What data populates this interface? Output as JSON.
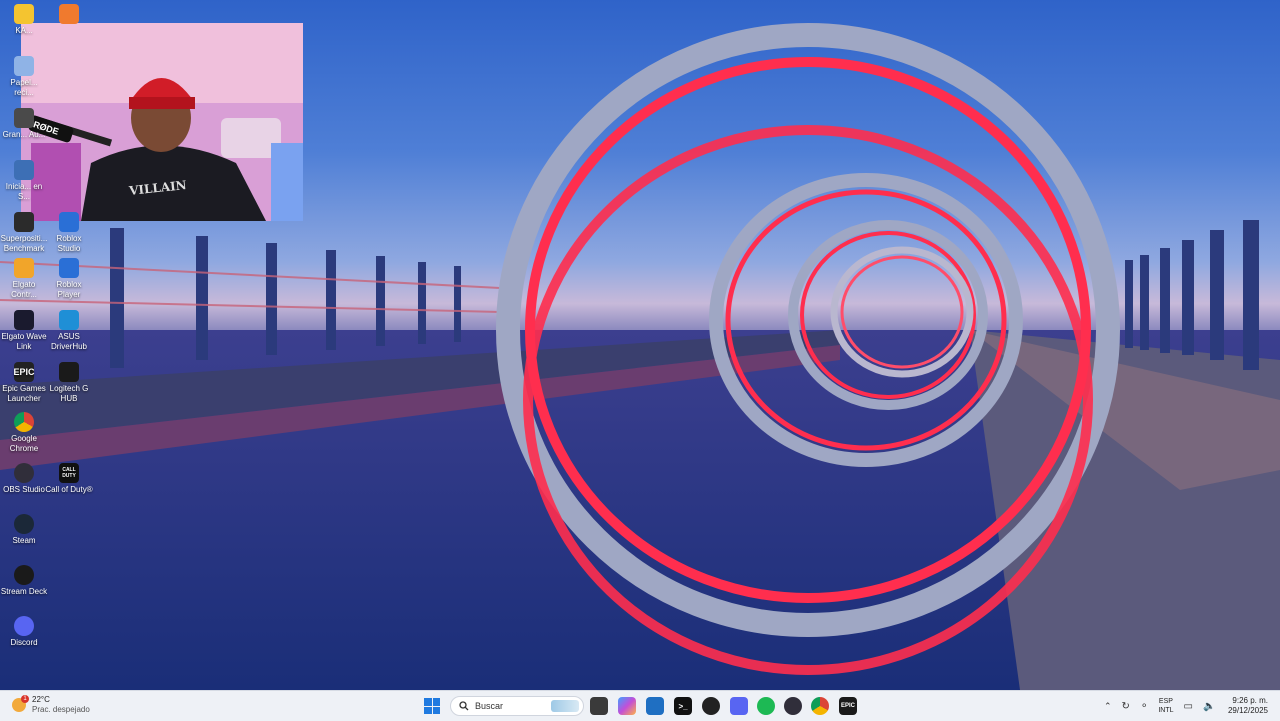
{
  "desktop": {
    "icons": [
      {
        "label": "KA...",
        "glyph": "",
        "color": "#f4c430"
      },
      {
        "label": "Papel... reci...",
        "glyph": "",
        "color": "#8fb3e6"
      },
      {
        "label": "Gran... Au...",
        "glyph": "",
        "color": "#4a4a4a"
      },
      {
        "label": "Inicia... en S...",
        "glyph": "",
        "color": "#3d6fb5"
      },
      {
        "label": "Superpositi... Benchmark",
        "glyph": "",
        "color": "#2b2b2b"
      },
      {
        "label": "Roblox Studio",
        "glyph": "",
        "color": "#2a6fd6"
      },
      {
        "label": "Elgato Contr...",
        "glyph": "",
        "color": "#f1a52a"
      },
      {
        "label": "Roblox Player",
        "glyph": "",
        "color": "#2a6fd6"
      },
      {
        "label": "Elgato Wave Link",
        "glyph": "",
        "color": "#1a1a2e"
      },
      {
        "label": "ASUS DriverHub",
        "glyph": "",
        "color": "#1f8fd6"
      },
      {
        "label": "Epic Games Launcher",
        "glyph": "EPIC",
        "color": "#222222"
      },
      {
        "label": "Logitech G HUB",
        "glyph": "",
        "color": "#1a1a1a"
      },
      {
        "label": "Google Chrome",
        "glyph": "",
        "color": "#db4437"
      },
      {
        "label": "OBS Studio",
        "glyph": "",
        "color": "#302e3a"
      },
      {
        "label": "Call of Duty®",
        "glyph": "CALL DUTY",
        "color": "#111111"
      },
      {
        "label": "Steam",
        "glyph": "",
        "color": "#1b2838"
      },
      {
        "label": "Stream Deck",
        "glyph": "",
        "color": "#1a1a1a"
      },
      {
        "label": "Discord",
        "glyph": "",
        "color": "#5865f2"
      }
    ]
  },
  "webcam": {
    "mic_brand": "RØDE",
    "hoodie_text": "VILLAIN"
  },
  "taskbar": {
    "weather": {
      "badge": "1",
      "temp": "22°C",
      "condition": "Prac. despejado"
    },
    "search_placeholder": "Buscar",
    "apps": [
      {
        "name": "file-explorer",
        "color": "#3a3a3a",
        "glyph": ""
      },
      {
        "name": "copilot",
        "color": "#c24fd8",
        "glyph": ""
      },
      {
        "name": "microsoft-store",
        "color": "#1f6fc2",
        "glyph": ""
      },
      {
        "name": "terminal",
        "color": "#111111",
        "glyph": ">_"
      },
      {
        "name": "app-6",
        "color": "#222222",
        "glyph": ""
      },
      {
        "name": "discord",
        "color": "#5865f2",
        "glyph": ""
      },
      {
        "name": "spotify",
        "color": "#1db954",
        "glyph": ""
      },
      {
        "name": "obs",
        "color": "#302e3a",
        "glyph": ""
      },
      {
        "name": "chrome",
        "color": "#db4437",
        "glyph": ""
      },
      {
        "name": "epic-games",
        "color": "#1a1a1a",
        "glyph": "EPIC"
      }
    ],
    "tray": {
      "lang_top": "ESP",
      "lang_bottom": "INTL"
    },
    "clock": {
      "time": "9:26 p. m.",
      "date": "29/12/2025"
    }
  }
}
